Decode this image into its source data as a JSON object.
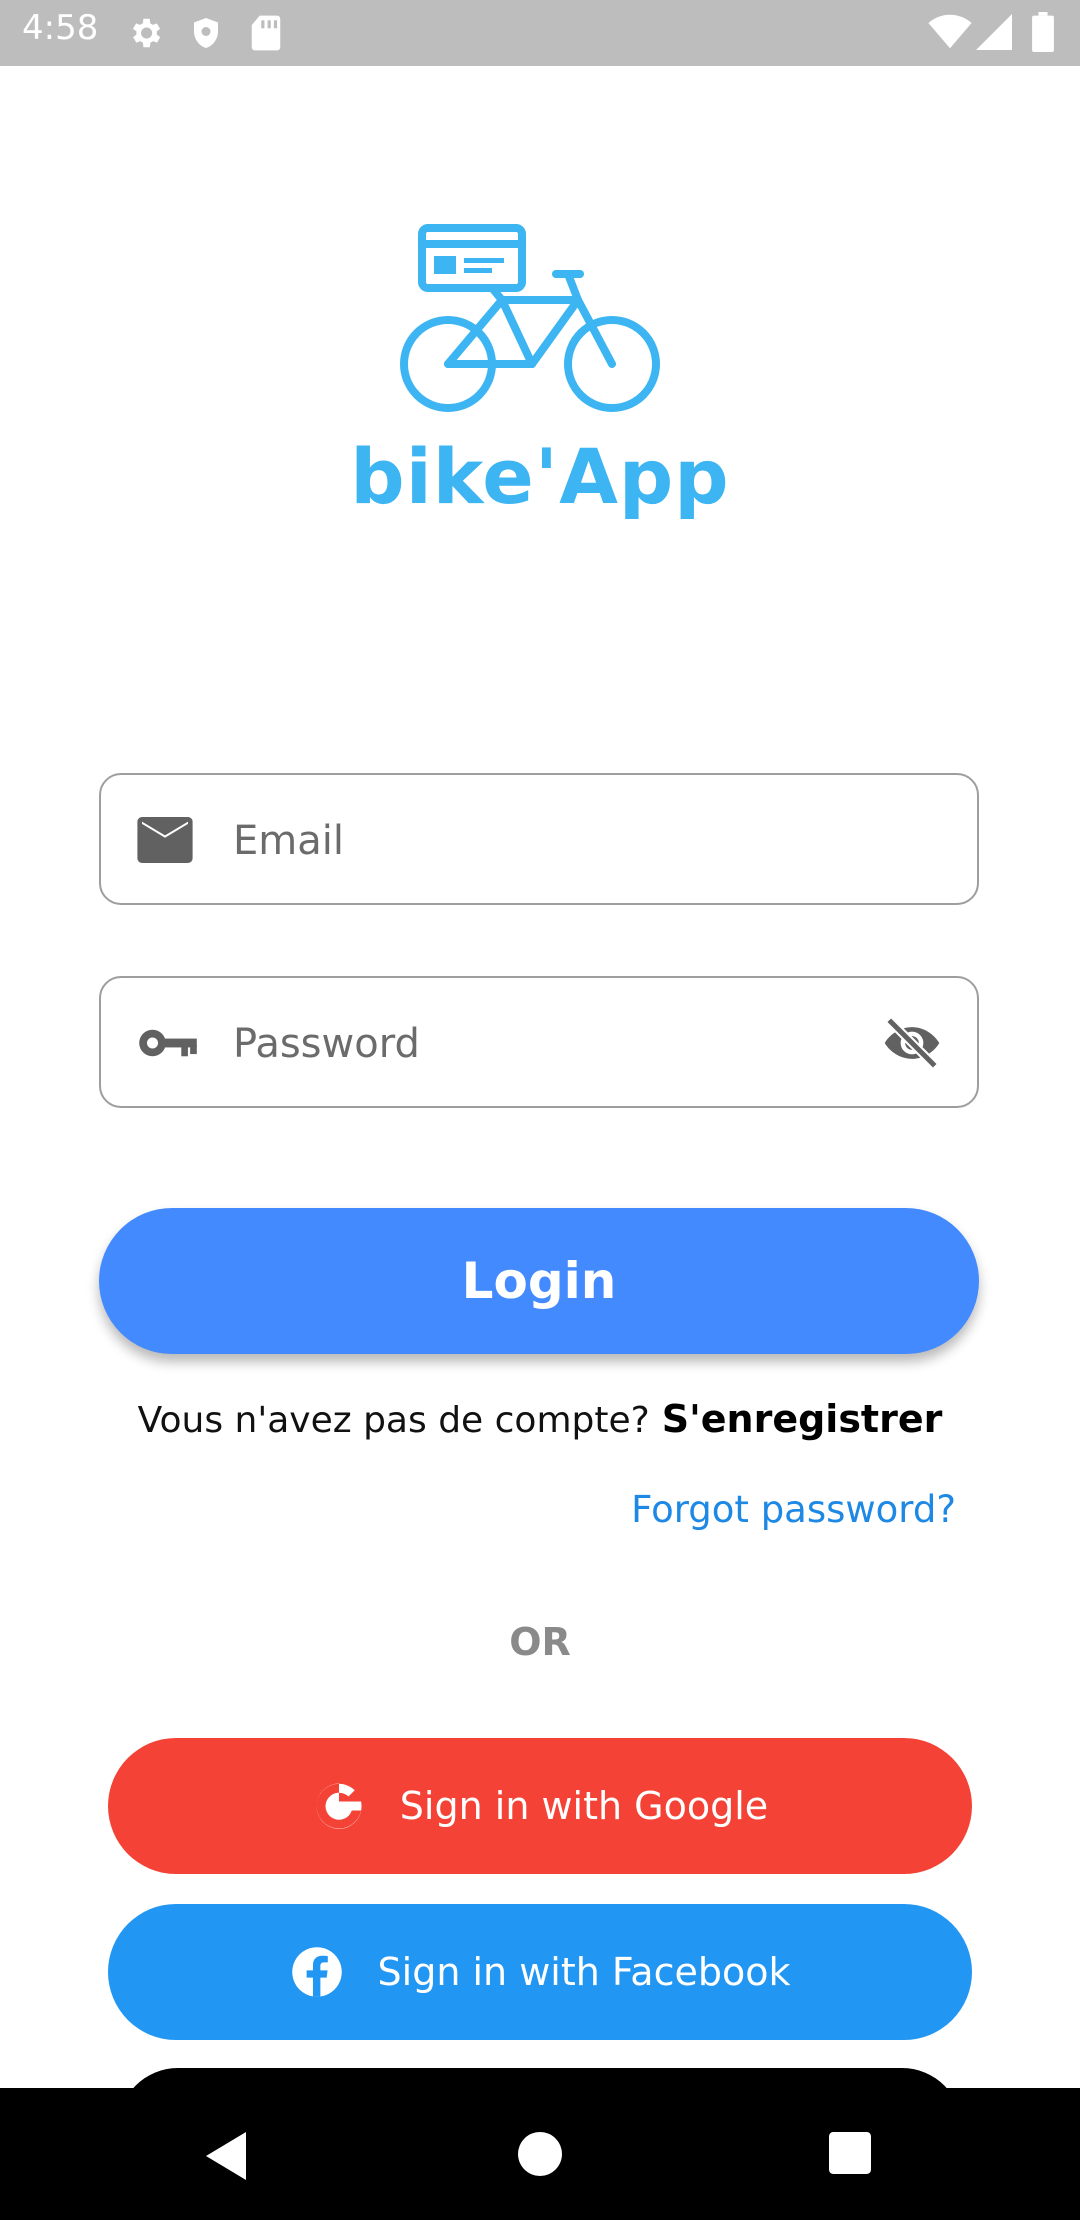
{
  "status_bar": {
    "time": "4:58",
    "icons_left": [
      "gear-icon",
      "shield-icon",
      "sd-card-icon"
    ],
    "icons_right": [
      "wifi-icon",
      "cell-signal-icon",
      "battery-icon"
    ]
  },
  "brand": {
    "name": "bike'App",
    "logo_icon": "bike-with-card-icon",
    "color": "#3cb5f2"
  },
  "form": {
    "email": {
      "placeholder": "Email",
      "value": "",
      "icon": "email-icon"
    },
    "password": {
      "placeholder": "Password",
      "value": "",
      "icon": "key-icon",
      "toggle_icon": "visibility-off-icon"
    },
    "login_label": "Login",
    "login_color": "#448aff"
  },
  "register": {
    "prompt": "Vous n'avez pas de compte?",
    "link": "S'enregistrer"
  },
  "forgot_password": "Forgot password?",
  "divider": "OR",
  "social": {
    "google": {
      "label": "Sign in with Google",
      "icon": "google-icon",
      "color": "#f44336"
    },
    "facebook": {
      "label": "Sign in with Facebook",
      "icon": "facebook-icon",
      "color": "#2196f3"
    }
  },
  "nav_bar": {
    "icons": [
      "back-icon",
      "home-icon",
      "recents-icon"
    ]
  }
}
